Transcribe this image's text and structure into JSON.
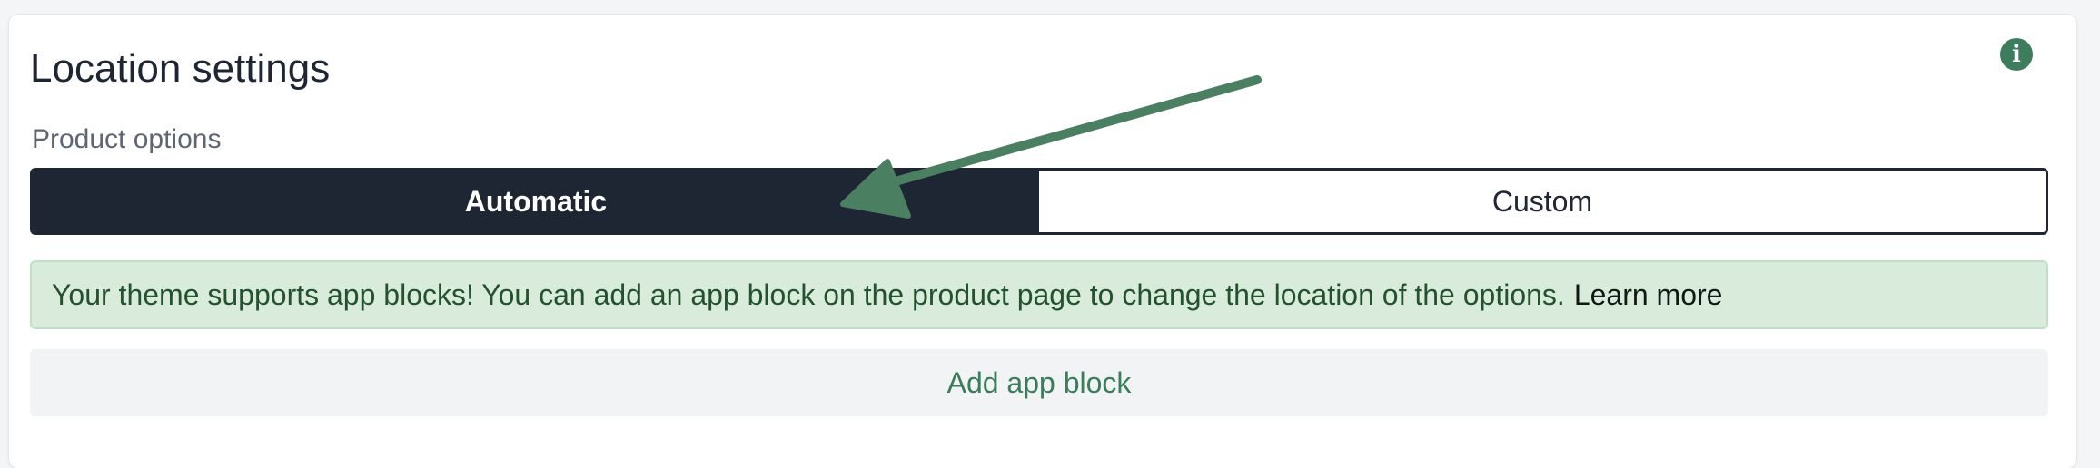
{
  "card": {
    "title": "Location settings",
    "info_icon_glyph": "i",
    "section_label": "Product options"
  },
  "product_options": {
    "options": [
      "Automatic",
      "Custom"
    ],
    "selected": "Automatic"
  },
  "banner": {
    "message": "Your theme supports app blocks! You can add an app block on the product page to change the location of the options.",
    "link_label": "Learn more"
  },
  "add_block": {
    "label": "Add app block"
  },
  "annotation": {
    "type": "arrow",
    "color": "#4a7f62"
  },
  "colors": {
    "accent": "#3d7c5c",
    "dark": "#1e2533",
    "success_bg": "#d9ecdc"
  }
}
